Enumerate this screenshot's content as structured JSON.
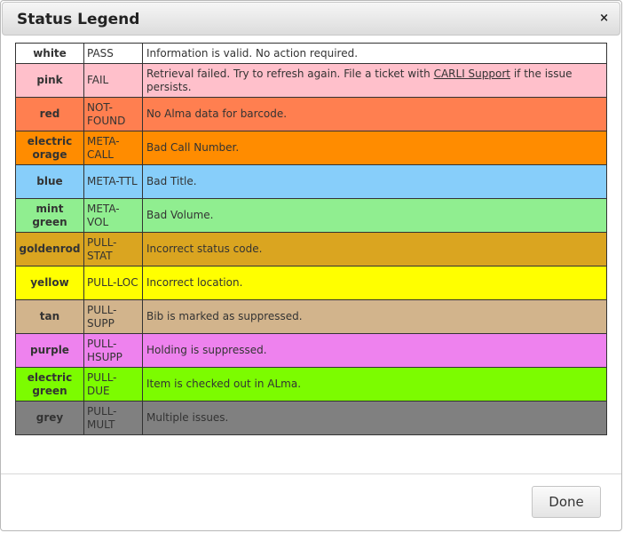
{
  "dialog": {
    "title": "Status Legend",
    "close_glyph": "×",
    "done_label": "Done"
  },
  "rows": [
    {
      "name": "white",
      "code": "PASS",
      "desc": "Information is valid. No action required.",
      "color": "#ffffff"
    },
    {
      "name": "pink",
      "code": "FAIL",
      "desc_before": "Retrieval failed. Try to refresh again. File a ticket with ",
      "link": "CARLI Support",
      "desc_after": " if the issue persists.",
      "color": "#ffc0cb"
    },
    {
      "name": "red",
      "code": "NOT-FOUND",
      "desc": "No Alma data for barcode.",
      "color": "#ff7f50"
    },
    {
      "name": "electric orage",
      "code": "META-CALL",
      "desc": "Bad Call Number.",
      "color": "#ff8c00"
    },
    {
      "name": "blue",
      "code": "META-TTL",
      "desc": "Bad Title.",
      "color": "#87cefa"
    },
    {
      "name": "mint green",
      "code": "META-VOL",
      "desc": "Bad Volume.",
      "color": "#90ee90"
    },
    {
      "name": "goldenrod",
      "code": "PULL-STAT",
      "desc": "Incorrect status code.",
      "color": "#daa520"
    },
    {
      "name": "yellow",
      "code": "PULL-LOC",
      "desc": "Incorrect location.",
      "color": "#ffff00"
    },
    {
      "name": "tan",
      "code": "PULL-SUPP",
      "desc": "Bib is marked as suppressed.",
      "color": "#d2b48c"
    },
    {
      "name": "purple",
      "code": "PULL-HSUPP",
      "desc": "Holding is suppressed.",
      "color": "#ee82ee"
    },
    {
      "name": "electric green",
      "code": "PULL-DUE",
      "desc": "Item is checked out in ALma.",
      "color": "#7cfc00"
    },
    {
      "name": "grey",
      "code": "PULL-MULT",
      "desc": "Multiple issues.",
      "color": "#808080"
    }
  ]
}
